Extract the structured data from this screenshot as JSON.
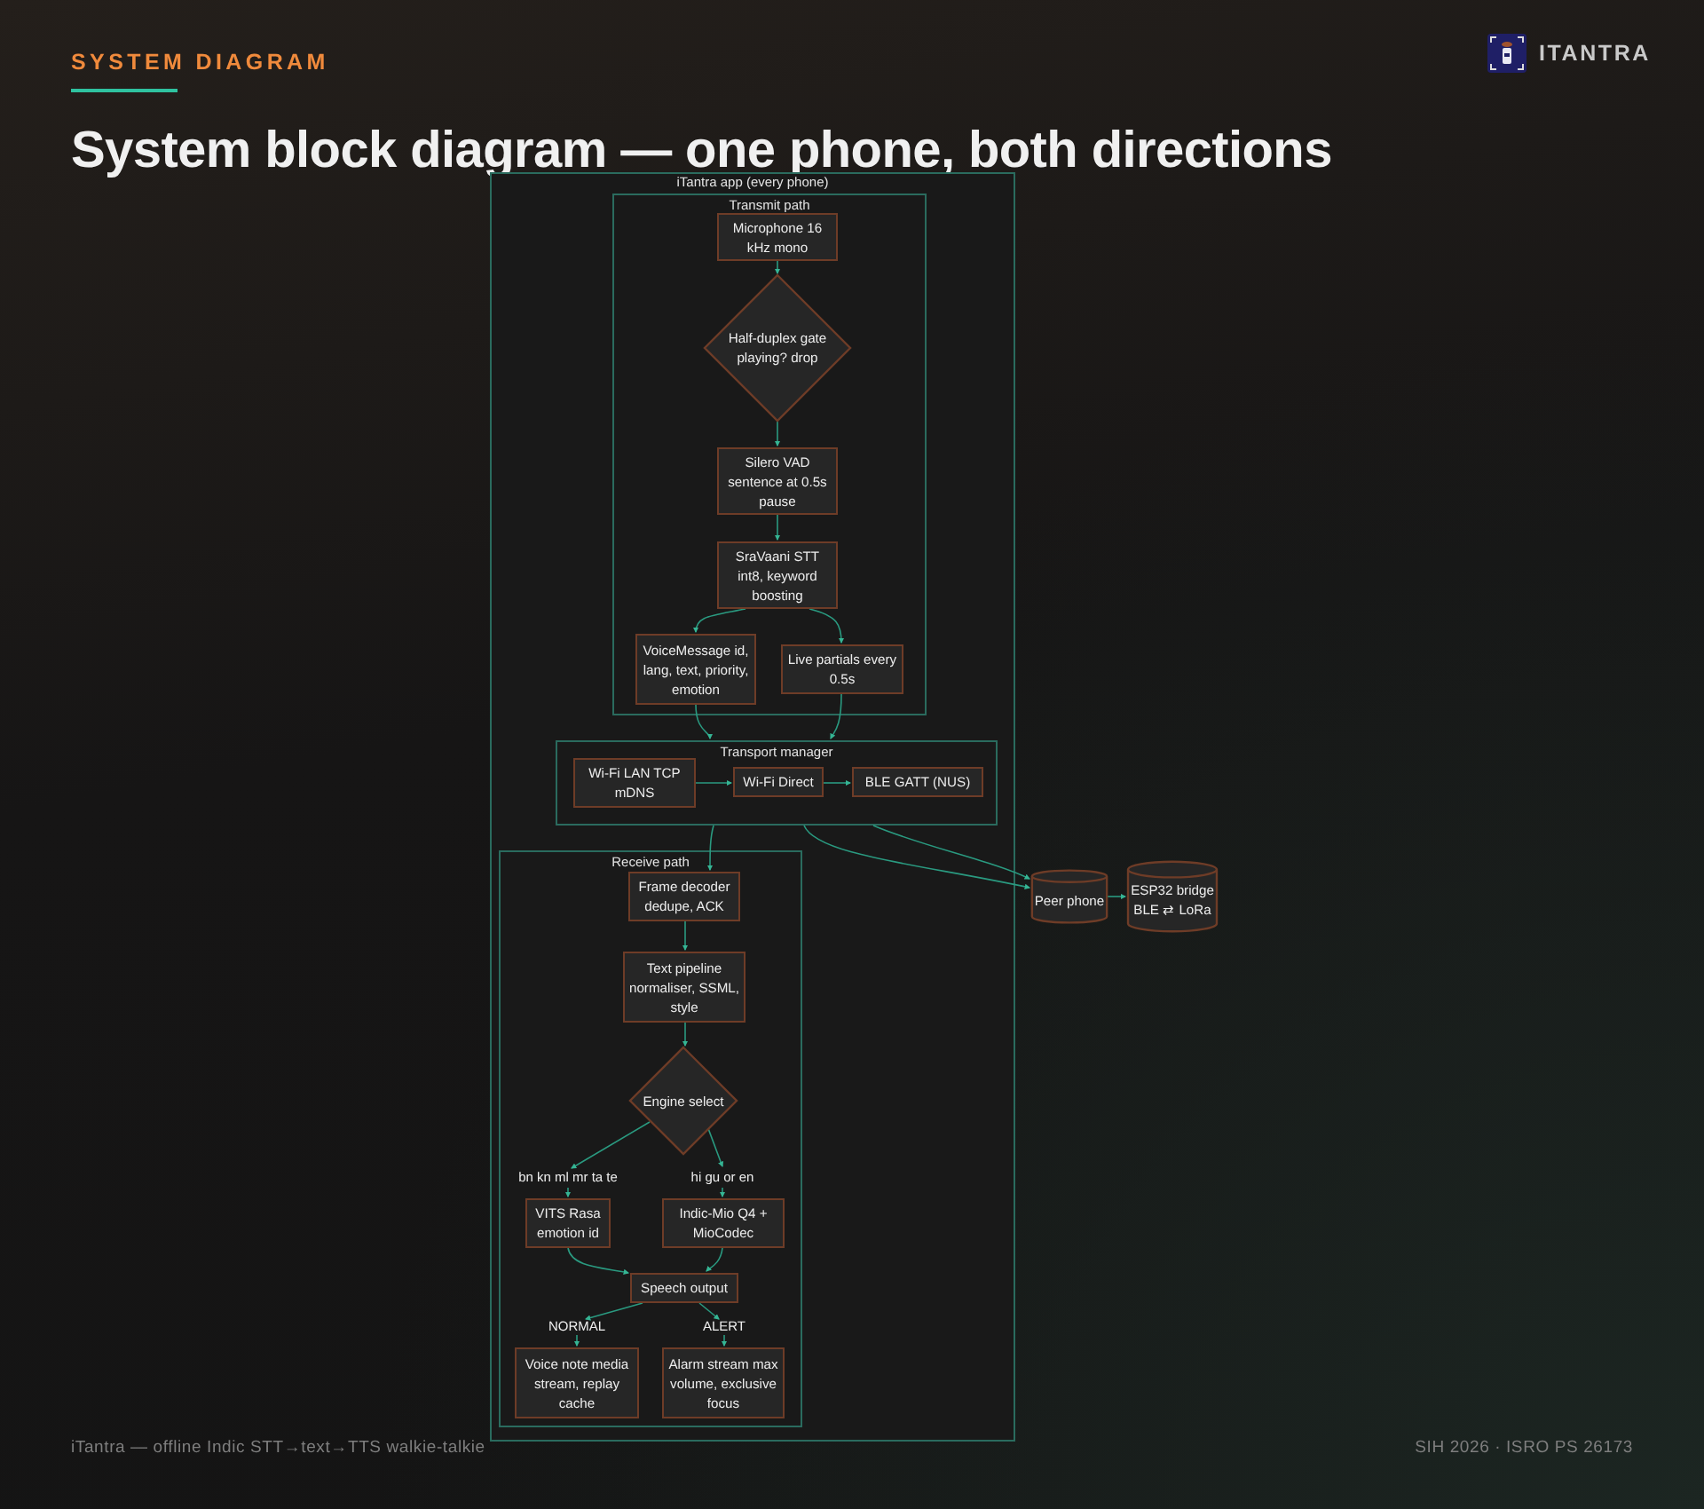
{
  "header": {
    "eyebrow": "SYSTEM DIAGRAM",
    "title": "System block diagram — one phone, both directions",
    "brand": "ITANTRA"
  },
  "diagram": {
    "groups": [
      {
        "label": "iTantra app (every phone)"
      },
      {
        "label": "Transmit path"
      },
      {
        "label": "Transport manager"
      },
      {
        "label": "Receive path"
      }
    ],
    "nodes": [
      {
        "kind": "box",
        "text": "Microphone 16 kHz mono"
      },
      {
        "kind": "diamond",
        "text": "Half-duplex gate playing? drop"
      },
      {
        "kind": "box",
        "text": "Silero VAD sentence at 0.5s pause"
      },
      {
        "kind": "box",
        "text": "SraVaani STT int8, keyword boosting"
      },
      {
        "kind": "box",
        "text": "VoiceMessage id, lang, text, priority, emotion"
      },
      {
        "kind": "box",
        "text": "Live partials every 0.5s"
      },
      {
        "kind": "box",
        "text": "Wi-Fi LAN TCP mDNS"
      },
      {
        "kind": "box",
        "text": "Wi-Fi Direct"
      },
      {
        "kind": "box",
        "text": "BLE GATT (NUS)"
      },
      {
        "kind": "box",
        "text": "Frame decoder dedupe, ACK"
      },
      {
        "kind": "box",
        "text": "Text pipeline normaliser, SSML, style"
      },
      {
        "kind": "diamond",
        "text": "Engine select"
      },
      {
        "kind": "box",
        "text": "VITS Rasa emotion id"
      },
      {
        "kind": "box",
        "text": "Indic-Mio Q4 + MioCodec"
      },
      {
        "kind": "box",
        "text": "Speech output"
      },
      {
        "kind": "box",
        "text": "Voice note media stream, replay cache"
      },
      {
        "kind": "box",
        "text": "Alarm stream max volume, exclusive focus"
      },
      {
        "kind": "cylinder",
        "text": "Peer phone"
      },
      {
        "kind": "cylinder",
        "text": "ESP32 bridge BLE ⇄ LoRa"
      }
    ],
    "edge_labels": [
      "bn kn ml mr ta te",
      "hi gu or en",
      "NORMAL",
      "ALERT"
    ]
  },
  "footer": {
    "left": "iTantra — offline Indic STT→text→TTS walkie-talkie",
    "right": "SIH 2026 · ISRO PS 26173"
  }
}
